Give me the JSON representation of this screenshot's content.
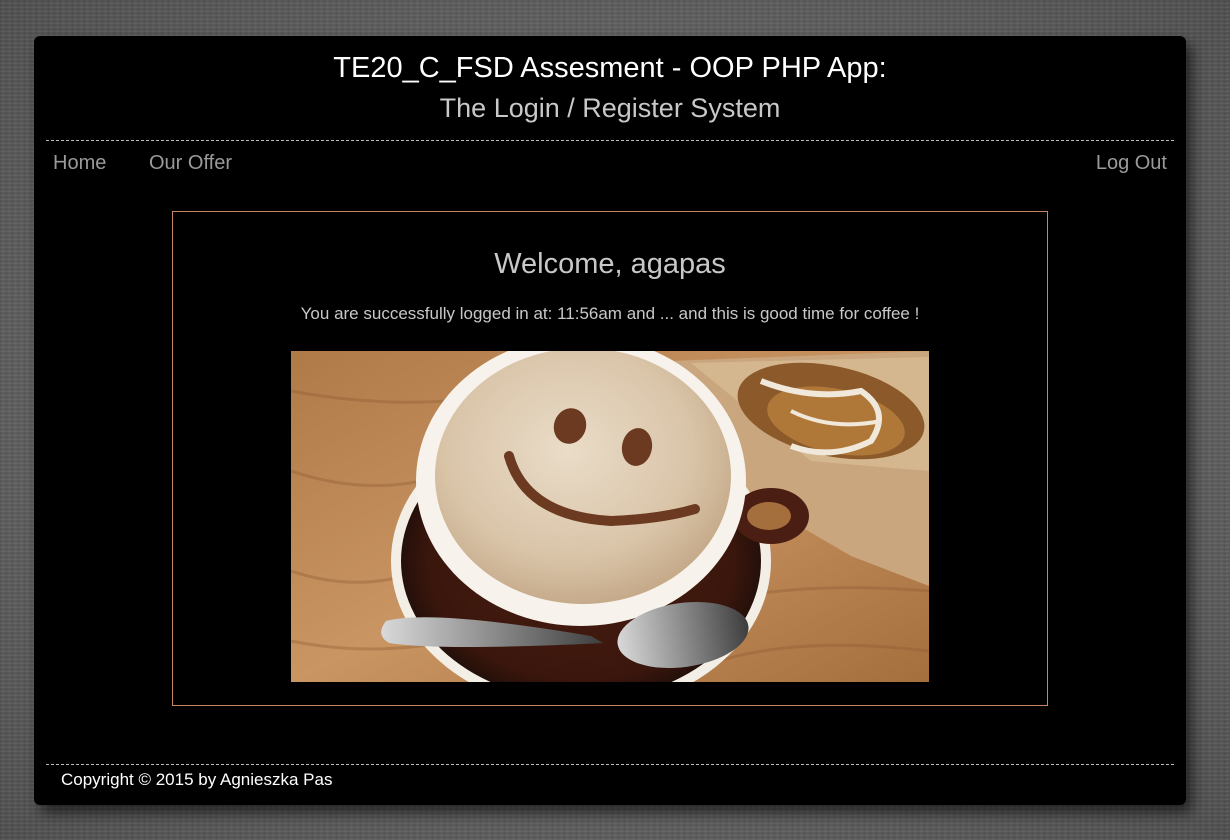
{
  "header": {
    "title": "TE20_C_FSD Assesment - OOP PHP App:",
    "subtitle": "The Login / Register System"
  },
  "nav": {
    "home": "Home",
    "our_offer": "Our Offer",
    "log_out": "Log Out"
  },
  "main": {
    "welcome": "Welcome, agapas",
    "message": "You are successfully logged in at: 11:56am and ... and this is good time for coffee !",
    "image": "coffee-smiley-latte-photo"
  },
  "footer": {
    "copyright": "Copyright © 2015 by Agnieszka Pas"
  },
  "colors": {
    "frame_background": "#000000",
    "panel_border": "#c98462",
    "nav_text": "#9a9a9a",
    "page_background": "#6a6a6a"
  }
}
